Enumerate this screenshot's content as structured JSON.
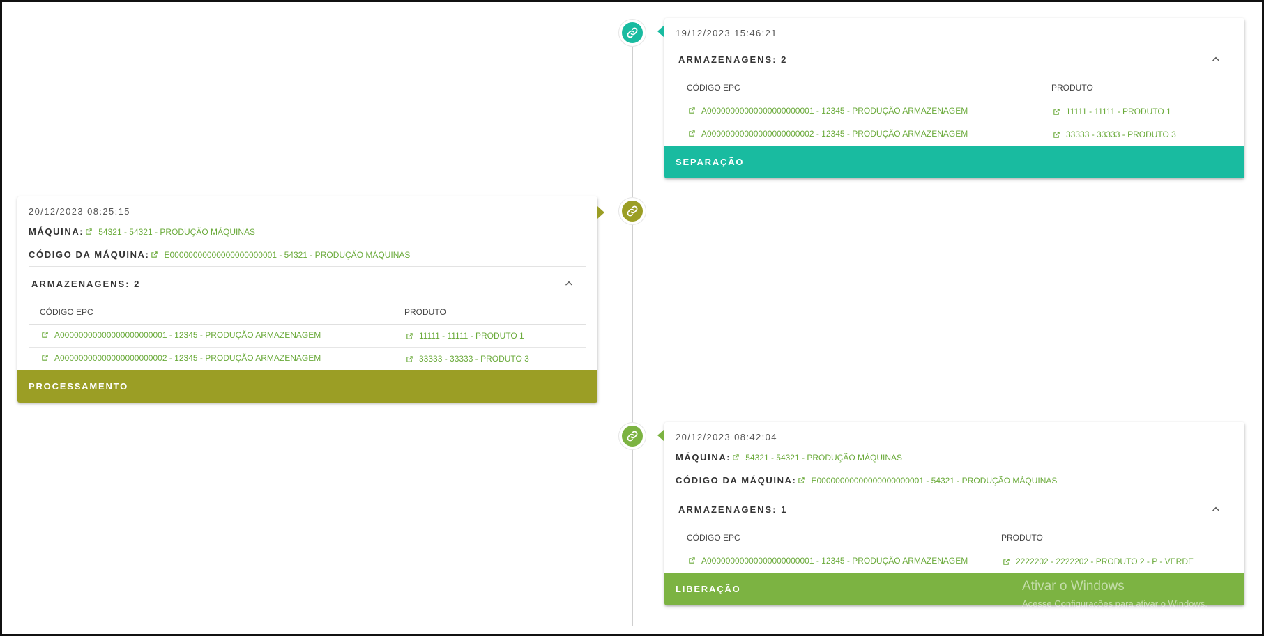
{
  "colors": {
    "teal": "#19bba0",
    "olive": "#9b9e25",
    "green": "#7cb342",
    "link": "#6aaa3a"
  },
  "cards": [
    {
      "timestamp": "19/12/2023 15:46:21",
      "section_title": "ARMAZENAGENS: 2",
      "col_epc": "CÓDIGO EPC",
      "col_produto": "PRODUTO",
      "rows": [
        {
          "epc": "A00000000000000000000001 - 12345 - PRODUÇÃO ARMAZENAGEM",
          "produto": "11111 - 11111 - PRODUTO 1"
        },
        {
          "epc": "A00000000000000000000002 - 12345 - PRODUÇÃO ARMAZENAGEM",
          "produto": "33333 - 33333 - PRODUTO 3"
        }
      ],
      "footer": "SEPARAÇÃO"
    },
    {
      "timestamp": "20/12/2023 08:25:15",
      "maquina_label": "MÁQUINA:",
      "maquina_value": "54321 - 54321 - PRODUÇÃO MÁQUINAS",
      "codigo_label": "CÓDIGO DA MÁQUINA:",
      "codigo_value": "E00000000000000000000001 - 54321 - PRODUÇÃO MÁQUINAS",
      "section_title": "ARMAZENAGENS: 2",
      "col_epc": "CÓDIGO EPC",
      "col_produto": "PRODUTO",
      "rows": [
        {
          "epc": "A00000000000000000000001 - 12345 - PRODUÇÃO ARMAZENAGEM",
          "produto": "11111 - 11111 - PRODUTO 1"
        },
        {
          "epc": "A00000000000000000000002 - 12345 - PRODUÇÃO ARMAZENAGEM",
          "produto": "33333 - 33333 - PRODUTO 3"
        }
      ],
      "footer": "PROCESSAMENTO"
    },
    {
      "timestamp": "20/12/2023 08:42:04",
      "maquina_label": "MÁQUINA:",
      "maquina_value": "54321 - 54321 - PRODUÇÃO MÁQUINAS",
      "codigo_label": "CÓDIGO DA MÁQUINA:",
      "codigo_value": "E00000000000000000000001 - 54321 - PRODUÇÃO MÁQUINAS",
      "section_title": "ARMAZENAGENS: 1",
      "col_epc": "CÓDIGO EPC",
      "col_produto": "PRODUTO",
      "rows": [
        {
          "epc": "A00000000000000000000001 - 12345 - PRODUÇÃO ARMAZENAGEM",
          "produto": "2222202 - 2222202 - PRODUTO 2 - P - VERDE"
        }
      ],
      "footer": "LIBERAÇÃO"
    }
  ],
  "icons": {
    "node": "link-icon",
    "external": "external-link-icon",
    "collapse": "chevron-up-icon"
  },
  "watermark": {
    "line1": "Ativar o Windows",
    "line2": "Acesse Configurações para ativar o Windows."
  }
}
